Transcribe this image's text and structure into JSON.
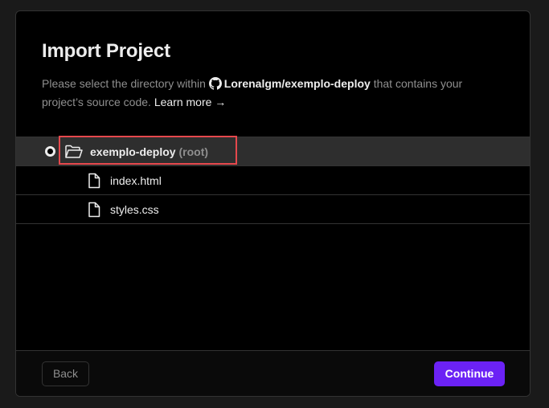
{
  "modal": {
    "title": "Import Project",
    "description_prefix": "Please select the directory within",
    "repo_name": "Lorenalgm/exemplo-deploy",
    "description_suffix": "that contains your project’s source code.",
    "learn_more": "Learn more →"
  },
  "tree": {
    "root": {
      "name": "exemplo-deploy",
      "tag": "(root)",
      "icon": "folder-open-icon",
      "selected": true
    },
    "files": [
      {
        "name": "index.html",
        "icon": "file-icon"
      },
      {
        "name": "styles.css",
        "icon": "file-icon"
      }
    ]
  },
  "footer": {
    "back_label": "Back",
    "continue_label": "Continue"
  },
  "colors": {
    "background": "#000000",
    "selected_row": "#2e2e2e",
    "highlight_border": "#e5484d",
    "primary_button": "#6b22f5",
    "muted_text": "#8f8f8f"
  }
}
